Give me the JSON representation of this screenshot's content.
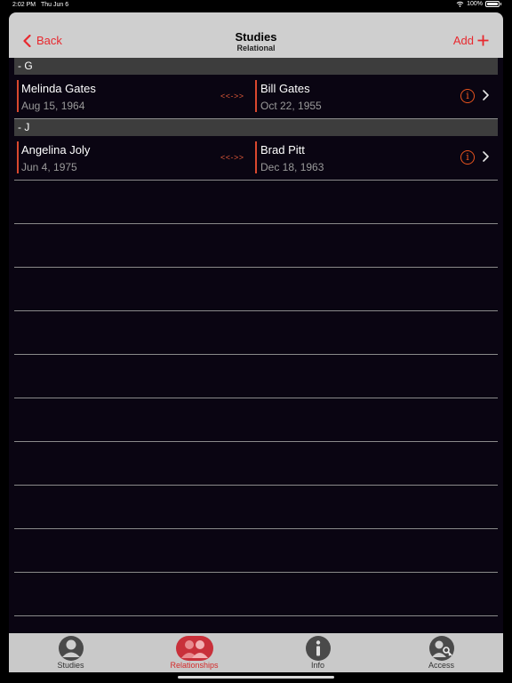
{
  "status": {
    "time": "2:02 PM",
    "date": "Thu Jun 6",
    "battery": "100%"
  },
  "nav": {
    "back_label": "Back",
    "title": "Studies",
    "subtitle": "Relational",
    "add_label": "Add"
  },
  "sections": [
    {
      "header": "- G",
      "rows": [
        {
          "left_name": "Melinda Gates",
          "left_date": "Aug 15, 1964",
          "connector": "<<->>",
          "right_name": "Bill Gates",
          "right_date": "Oct 22, 1955"
        }
      ]
    },
    {
      "header": "- J",
      "rows": [
        {
          "left_name": "Angelina Joly",
          "left_date": "Jun 4, 1975",
          "connector": "<<->>",
          "right_name": "Brad Pitt",
          "right_date": "Dec 18, 1963"
        }
      ]
    }
  ],
  "tabs": [
    {
      "label": "Studies",
      "icon": "person-icon",
      "active": false
    },
    {
      "label": "Relationships",
      "icon": "people-icon",
      "active": true
    },
    {
      "label": "Info",
      "icon": "info-icon",
      "active": false
    },
    {
      "label": "Access",
      "icon": "key-icon",
      "active": false
    }
  ],
  "colors": {
    "accent": "#e8282e",
    "connector": "#e05a3a",
    "info": "#e8541e",
    "tab_active": "#d42a2a"
  }
}
